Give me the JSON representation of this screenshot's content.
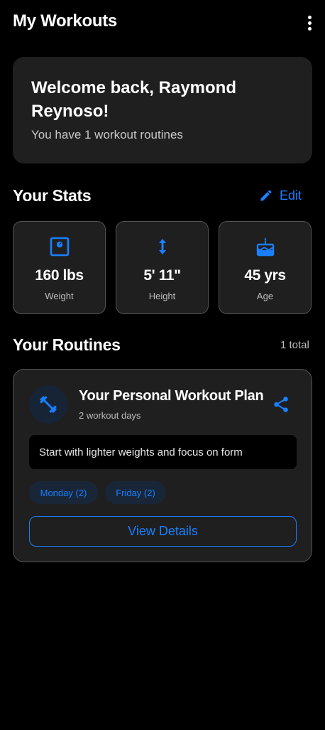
{
  "appbar": {
    "title": "My Workouts",
    "menu_icon": "more-vert-icon"
  },
  "welcome": {
    "title": "Welcome back, Raymond Reynoso!",
    "subtitle": "You have 1 workout routines"
  },
  "stats": {
    "section_title": "Your Stats",
    "edit_label": "Edit",
    "items": [
      {
        "icon": "scale-icon",
        "value": "160 lbs",
        "label": "Weight"
      },
      {
        "icon": "height-icon",
        "value": "5' 11\"",
        "label": "Height"
      },
      {
        "icon": "cake-icon",
        "value": "45 yrs",
        "label": "Age"
      }
    ]
  },
  "routines": {
    "section_title": "Your Routines",
    "total": "1 total",
    "items": [
      {
        "icon": "dumbbell-icon",
        "title": "Your Personal Workout Plan",
        "subtitle": "2 workout days",
        "note": "Start with lighter weights and focus on form",
        "days": [
          "Monday (2)",
          "Friday (2)"
        ],
        "action_label": "View Details"
      }
    ]
  },
  "colors": {
    "background": "#000000",
    "card": "#1f1f1f",
    "accent": "#1a7fff",
    "chip_bg": "#182638",
    "border": "#545454"
  }
}
